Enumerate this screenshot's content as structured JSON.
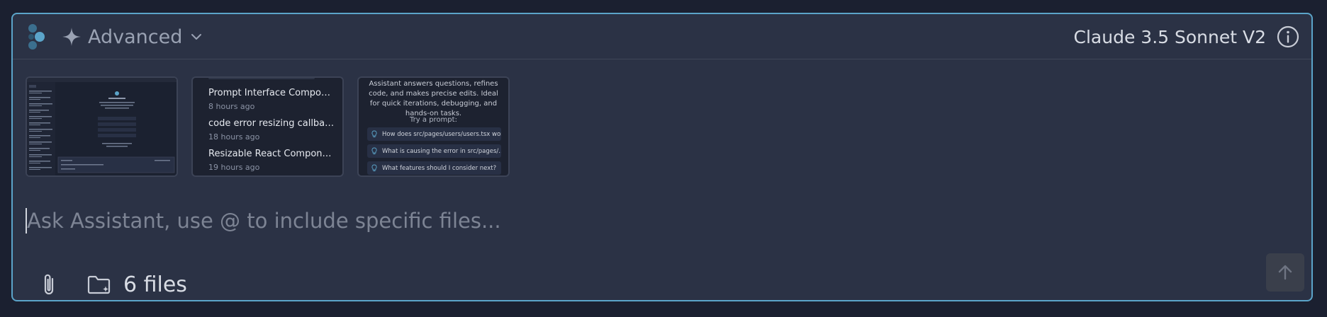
{
  "header": {
    "mode_label": "Advanced",
    "model_label": "Claude 3.5 Sonnet V2"
  },
  "attachments": {
    "chats": [
      {
        "title": "Prompt Interface Component D...",
        "time": "8 hours ago"
      },
      {
        "title": "code error resizing callback dat...",
        "time": "18 hours ago"
      },
      {
        "title": "Resizable React Component Si...",
        "time": "19 hours ago"
      }
    ],
    "prompt_card": {
      "description": "Assistant answers questions, refines code, and makes precise edits. Ideal for quick iterations, debugging, and hands-on tasks.",
      "try_label": "Try a prompt:",
      "suggestions": [
        "How does src/pages/users/users.tsx work?",
        "What is causing the error in src/pages/.../users.tsx?",
        "What features should I consider next?"
      ]
    }
  },
  "input": {
    "placeholder": "Ask Assistant, use @ to include specific files..."
  },
  "footer": {
    "files_label": "6 files"
  },
  "colors": {
    "accent_border": "#5ba4c9",
    "panel_bg": "#2b3245",
    "page_bg": "#1b2030"
  }
}
